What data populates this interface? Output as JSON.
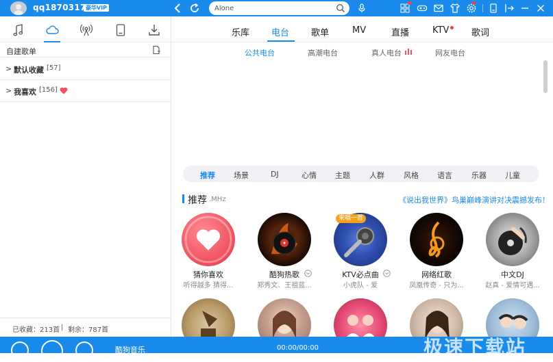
{
  "header": {
    "username": "qq1870317...",
    "vip_badge": "豪华VIP",
    "search_value": "Alone"
  },
  "sidebar": {
    "section_title": "自建歌单",
    "playlists": [
      {
        "name": "默认收藏",
        "count": "[57]"
      },
      {
        "name": "我喜欢",
        "count": "[156]"
      }
    ],
    "footer": {
      "saved": "已收藏：213首",
      "separator": "|",
      "remaining": "剩余：787首"
    }
  },
  "main": {
    "tabs": [
      "乐库",
      "电台",
      "歌单",
      "MV",
      "直播",
      "KTV",
      "歌词"
    ],
    "active_tab": "电台",
    "subtabs": [
      "公共电台",
      "高潮电台",
      "真人电台",
      "网友电台"
    ],
    "categories": [
      "推荐",
      "场景",
      "DJ",
      "心情",
      "主题",
      "人群",
      "风格",
      "语言",
      "乐器",
      "儿童"
    ],
    "recommend": {
      "title": "推荐",
      "unit": ".MHz",
      "promo": "《说出我世界》鸟巢巅峰演讲对决震撼发布！"
    },
    "stations": [
      {
        "title": "猜你喜欢",
        "sub": "听得越多 猜得..."
      },
      {
        "title": "酷狗热歌",
        "sub": "郑秀文、王祖蓝..."
      },
      {
        "title": "KTV必点曲",
        "sub": "小虎队 - 爱",
        "badge": "来唱一首"
      },
      {
        "title": "网络红歌",
        "sub": "凤凰传奇 - 只为..."
      },
      {
        "title": "中文DJ",
        "sub": "赵真 - 爱情可遇..."
      }
    ]
  },
  "player": {
    "song": "酷狗音乐",
    "time": "00:00/00:00",
    "watermark": "极速下载站"
  },
  "colors": {
    "accent": "#1a8bea",
    "heart": "#f0525e"
  }
}
